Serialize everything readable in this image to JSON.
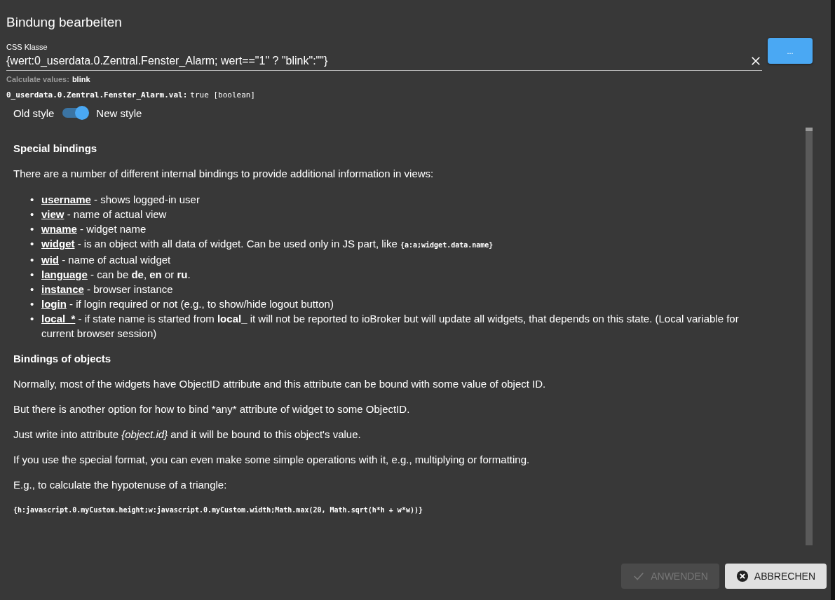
{
  "dialog": {
    "title": "Bindung bearbeiten"
  },
  "css_field": {
    "label": "CSS Klasse",
    "value": "{wert:0_userdata.0.Zentral.Fenster_Alarm; wert==\"1\" ? \"blink\":\"\"}",
    "more_button": "..."
  },
  "calculated": {
    "label": "Calculate values:",
    "value": "blink"
  },
  "state_line": {
    "id": "0_userdata.0.Zentral.Fenster_Alarm.val:",
    "value": "true [boolean]"
  },
  "style_switch": {
    "left_label": "Old style",
    "right_label": "New style",
    "on": true
  },
  "help": [
    {
      "kind": "heading",
      "text": "Special bindings"
    },
    {
      "kind": "rich",
      "text": "There are a number of different internal bindings to provide additional information in views:"
    },
    {
      "kind": "list",
      "items": [
        {
          "bullet": "•",
          "term": "username",
          "text": " - shows logged-in user"
        },
        {
          "bullet": "•",
          "term": "view",
          "text": " - name of actual view"
        },
        {
          "bullet": "•",
          "term": "wname",
          "text": " - widget name"
        },
        {
          "bullet": "•",
          "term": "widget",
          "text": " - is an object with all data of widget. Can be used only in JS part, like ",
          "code": "{a:a;widget.data.name}"
        },
        {
          "bullet": "•",
          "term": "wid",
          "text": " - name of actual widget"
        },
        {
          "bullet": "•",
          "term": "language",
          "text": " - can be **de**, **en** or **ru**."
        },
        {
          "bullet": "•",
          "term": "instance",
          "text": " - browser instance"
        },
        {
          "bullet": "•",
          "term": "login",
          "text": " - if login required or not (e.g., to show/hide logout button)"
        },
        {
          "bullet": "•",
          "term": "local_*",
          "text": " - if state name is started from **local_** it will not be reported to ioBroker but will update all widgets, that depends on this state. (Local variable for current browser session)"
        }
      ]
    },
    {
      "kind": "heading",
      "text": "Bindings of objects"
    },
    {
      "kind": "rich",
      "text": "Normally, most of the widgets have ObjectID attribute and this attribute can be bound with some value of object ID."
    },
    {
      "kind": "plain",
      "text": "But there is another option for how to bind *any* attribute of widget to some ObjectID."
    },
    {
      "kind": "rich",
      "text": "Just write into attribute *{object.id}* and it will be bound to this object's value."
    },
    {
      "kind": "rich",
      "text": "If you use the special format, you can even make some simple operations with it, e.g., multiplying or formatting."
    },
    {
      "kind": "rich",
      "text": "E.g., to calculate the hypotenuse of a triangle:"
    },
    {
      "kind": "code",
      "text": "{h:javascript.0.myCustom.height;w:javascript.0.myCustom.width;Math.max(20, Math.sqrt(h*h + w*w))}"
    }
  ],
  "buttons": [
    {
      "kind": "apply",
      "label": "ANWENDEN",
      "disabled": true
    },
    {
      "kind": "cancel",
      "label": "ABBRECHEN",
      "disabled": false
    }
  ]
}
